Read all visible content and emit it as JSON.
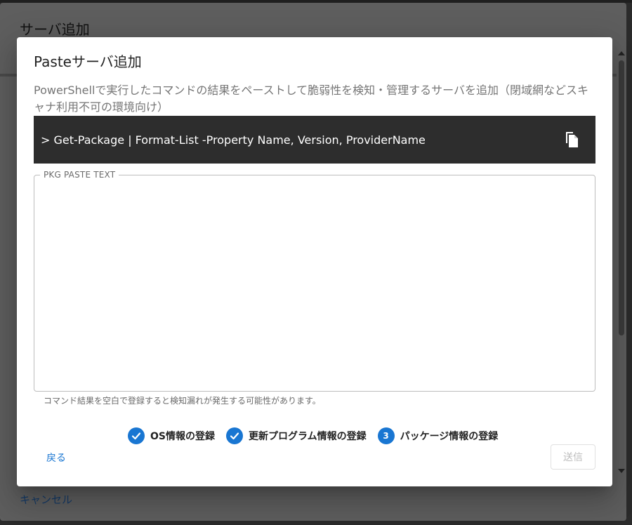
{
  "background": {
    "title": "サーバ追加",
    "cancel_label": "キャンセル"
  },
  "dialog": {
    "title": "Pasteサーバ追加",
    "description": "PowerShellで実行したコマンドの結果をペーストして脆弱性を検知・管理するサーバを追加（閉域網などスキャナ利用不可の環境向け）",
    "command": ">  Get-Package | Format-List -Property Name, Version, ProviderName",
    "copy_icon": "copy-icon",
    "field_label": "PKG PASTE TEXT",
    "field_value": "",
    "helper_text": "コマンド結果を空白で登録すると検知漏れが発生する可能性があります。",
    "steps": [
      {
        "indicator": "check",
        "label": "OS情報の登録",
        "state": "completed"
      },
      {
        "indicator": "check",
        "label": "更新プログラム情報の登録",
        "state": "completed"
      },
      {
        "indicator": "3",
        "label": "パッケージ情報の登録",
        "state": "active"
      }
    ],
    "back_label": "戻る",
    "submit_label": "送信"
  },
  "colors": {
    "primary": "#1976d2",
    "command_bg": "#2d2d2d",
    "overlay": "#5e5e5e"
  }
}
